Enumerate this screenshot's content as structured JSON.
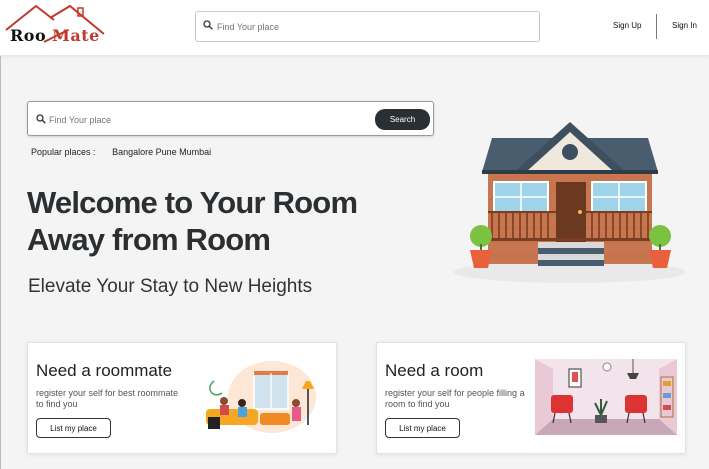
{
  "header": {
    "logo": {
      "part1": "Roo",
      "part2": "Mate"
    },
    "search": {
      "placeholder": "Find Your place"
    },
    "nav": {
      "sign_up": "Sign Up",
      "sign_in": "Sign In"
    }
  },
  "hero": {
    "search": {
      "placeholder": "Find Your place",
      "button": "Search"
    },
    "popular": {
      "label": "Popular places :",
      "cities": [
        "Bangalore",
        "Pune",
        "Mumbai"
      ]
    },
    "headline_line1": "Welcome to Your Room",
    "headline_line2": "Away from Room",
    "subline": "Elevate Your Stay to New Heights"
  },
  "cards": [
    {
      "title": "Need a roommate",
      "description": "register your self for best roommate to find you",
      "button": "List my place",
      "icon": "people-illustration-icon"
    },
    {
      "title": "Need a room",
      "description": "register your self for people filling a room to find you",
      "button": "List my place",
      "icon": "room-interior-illustration-icon"
    }
  ],
  "colors": {
    "brand_red": "#c0392b",
    "button_dark": "#2a2f33",
    "headline": "#2b2f31",
    "roof": "#4a5d6e",
    "brick": "#c8764f"
  }
}
